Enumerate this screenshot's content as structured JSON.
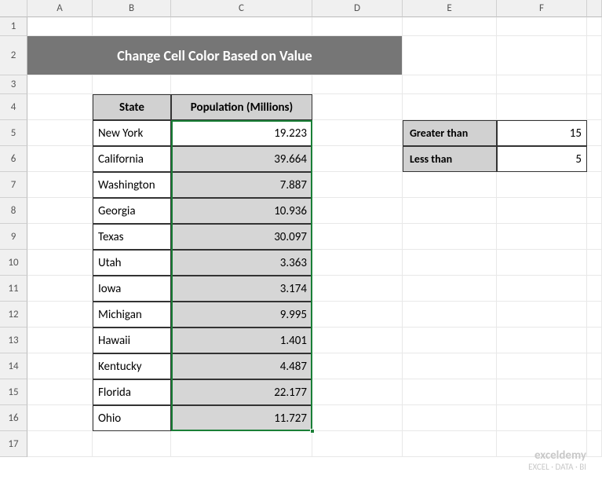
{
  "columns": [
    "A",
    "B",
    "C",
    "D",
    "E",
    "F"
  ],
  "row_count": 17,
  "title": "Change Cell Color Based on Value",
  "table": {
    "headers": {
      "state": "State",
      "population": "Population (Millions)"
    },
    "rows": [
      {
        "state": "New York",
        "population": "19.223"
      },
      {
        "state": "California",
        "population": "39.664"
      },
      {
        "state": "Washington",
        "population": "7.887"
      },
      {
        "state": "Georgia",
        "population": "10.936"
      },
      {
        "state": "Texas",
        "population": "30.097"
      },
      {
        "state": "Utah",
        "population": "3.363"
      },
      {
        "state": "Iowa",
        "population": "3.174"
      },
      {
        "state": "Michigan",
        "population": "9.995"
      },
      {
        "state": "Hawaii",
        "population": "1.401"
      },
      {
        "state": "Kentucky",
        "population": "4.487"
      },
      {
        "state": "Florida",
        "population": "22.177"
      },
      {
        "state": "Ohio",
        "population": "11.727"
      }
    ]
  },
  "side": {
    "gt_label": "Greater than",
    "gt_value": "15",
    "lt_label": "Less than",
    "lt_value": "5"
  },
  "watermark": {
    "brand": "exceldemy",
    "tag": "EXCEL · DATA · BI"
  }
}
